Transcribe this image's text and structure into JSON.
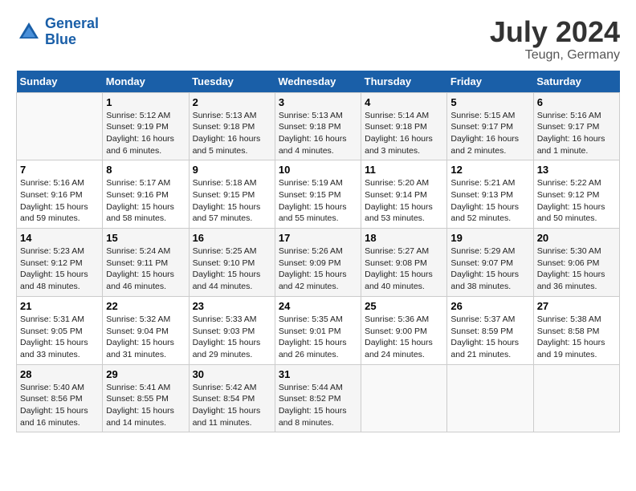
{
  "header": {
    "logo_line1": "General",
    "logo_line2": "Blue",
    "month": "July 2024",
    "location": "Teugn, Germany"
  },
  "weekdays": [
    "Sunday",
    "Monday",
    "Tuesday",
    "Wednesday",
    "Thursday",
    "Friday",
    "Saturday"
  ],
  "weeks": [
    [
      {
        "day": null,
        "info": null
      },
      {
        "day": "1",
        "info": "Sunrise: 5:12 AM\nSunset: 9:19 PM\nDaylight: 16 hours\nand 6 minutes."
      },
      {
        "day": "2",
        "info": "Sunrise: 5:13 AM\nSunset: 9:18 PM\nDaylight: 16 hours\nand 5 minutes."
      },
      {
        "day": "3",
        "info": "Sunrise: 5:13 AM\nSunset: 9:18 PM\nDaylight: 16 hours\nand 4 minutes."
      },
      {
        "day": "4",
        "info": "Sunrise: 5:14 AM\nSunset: 9:18 PM\nDaylight: 16 hours\nand 3 minutes."
      },
      {
        "day": "5",
        "info": "Sunrise: 5:15 AM\nSunset: 9:17 PM\nDaylight: 16 hours\nand 2 minutes."
      },
      {
        "day": "6",
        "info": "Sunrise: 5:16 AM\nSunset: 9:17 PM\nDaylight: 16 hours\nand 1 minute."
      }
    ],
    [
      {
        "day": "7",
        "info": "Sunrise: 5:16 AM\nSunset: 9:16 PM\nDaylight: 15 hours\nand 59 minutes."
      },
      {
        "day": "8",
        "info": "Sunrise: 5:17 AM\nSunset: 9:16 PM\nDaylight: 15 hours\nand 58 minutes."
      },
      {
        "day": "9",
        "info": "Sunrise: 5:18 AM\nSunset: 9:15 PM\nDaylight: 15 hours\nand 57 minutes."
      },
      {
        "day": "10",
        "info": "Sunrise: 5:19 AM\nSunset: 9:15 PM\nDaylight: 15 hours\nand 55 minutes."
      },
      {
        "day": "11",
        "info": "Sunrise: 5:20 AM\nSunset: 9:14 PM\nDaylight: 15 hours\nand 53 minutes."
      },
      {
        "day": "12",
        "info": "Sunrise: 5:21 AM\nSunset: 9:13 PM\nDaylight: 15 hours\nand 52 minutes."
      },
      {
        "day": "13",
        "info": "Sunrise: 5:22 AM\nSunset: 9:12 PM\nDaylight: 15 hours\nand 50 minutes."
      }
    ],
    [
      {
        "day": "14",
        "info": "Sunrise: 5:23 AM\nSunset: 9:12 PM\nDaylight: 15 hours\nand 48 minutes."
      },
      {
        "day": "15",
        "info": "Sunrise: 5:24 AM\nSunset: 9:11 PM\nDaylight: 15 hours\nand 46 minutes."
      },
      {
        "day": "16",
        "info": "Sunrise: 5:25 AM\nSunset: 9:10 PM\nDaylight: 15 hours\nand 44 minutes."
      },
      {
        "day": "17",
        "info": "Sunrise: 5:26 AM\nSunset: 9:09 PM\nDaylight: 15 hours\nand 42 minutes."
      },
      {
        "day": "18",
        "info": "Sunrise: 5:27 AM\nSunset: 9:08 PM\nDaylight: 15 hours\nand 40 minutes."
      },
      {
        "day": "19",
        "info": "Sunrise: 5:29 AM\nSunset: 9:07 PM\nDaylight: 15 hours\nand 38 minutes."
      },
      {
        "day": "20",
        "info": "Sunrise: 5:30 AM\nSunset: 9:06 PM\nDaylight: 15 hours\nand 36 minutes."
      }
    ],
    [
      {
        "day": "21",
        "info": "Sunrise: 5:31 AM\nSunset: 9:05 PM\nDaylight: 15 hours\nand 33 minutes."
      },
      {
        "day": "22",
        "info": "Sunrise: 5:32 AM\nSunset: 9:04 PM\nDaylight: 15 hours\nand 31 minutes."
      },
      {
        "day": "23",
        "info": "Sunrise: 5:33 AM\nSunset: 9:03 PM\nDaylight: 15 hours\nand 29 minutes."
      },
      {
        "day": "24",
        "info": "Sunrise: 5:35 AM\nSunset: 9:01 PM\nDaylight: 15 hours\nand 26 minutes."
      },
      {
        "day": "25",
        "info": "Sunrise: 5:36 AM\nSunset: 9:00 PM\nDaylight: 15 hours\nand 24 minutes."
      },
      {
        "day": "26",
        "info": "Sunrise: 5:37 AM\nSunset: 8:59 PM\nDaylight: 15 hours\nand 21 minutes."
      },
      {
        "day": "27",
        "info": "Sunrise: 5:38 AM\nSunset: 8:58 PM\nDaylight: 15 hours\nand 19 minutes."
      }
    ],
    [
      {
        "day": "28",
        "info": "Sunrise: 5:40 AM\nSunset: 8:56 PM\nDaylight: 15 hours\nand 16 minutes."
      },
      {
        "day": "29",
        "info": "Sunrise: 5:41 AM\nSunset: 8:55 PM\nDaylight: 15 hours\nand 14 minutes."
      },
      {
        "day": "30",
        "info": "Sunrise: 5:42 AM\nSunset: 8:54 PM\nDaylight: 15 hours\nand 11 minutes."
      },
      {
        "day": "31",
        "info": "Sunrise: 5:44 AM\nSunset: 8:52 PM\nDaylight: 15 hours\nand 8 minutes."
      },
      {
        "day": null,
        "info": null
      },
      {
        "day": null,
        "info": null
      },
      {
        "day": null,
        "info": null
      }
    ]
  ]
}
